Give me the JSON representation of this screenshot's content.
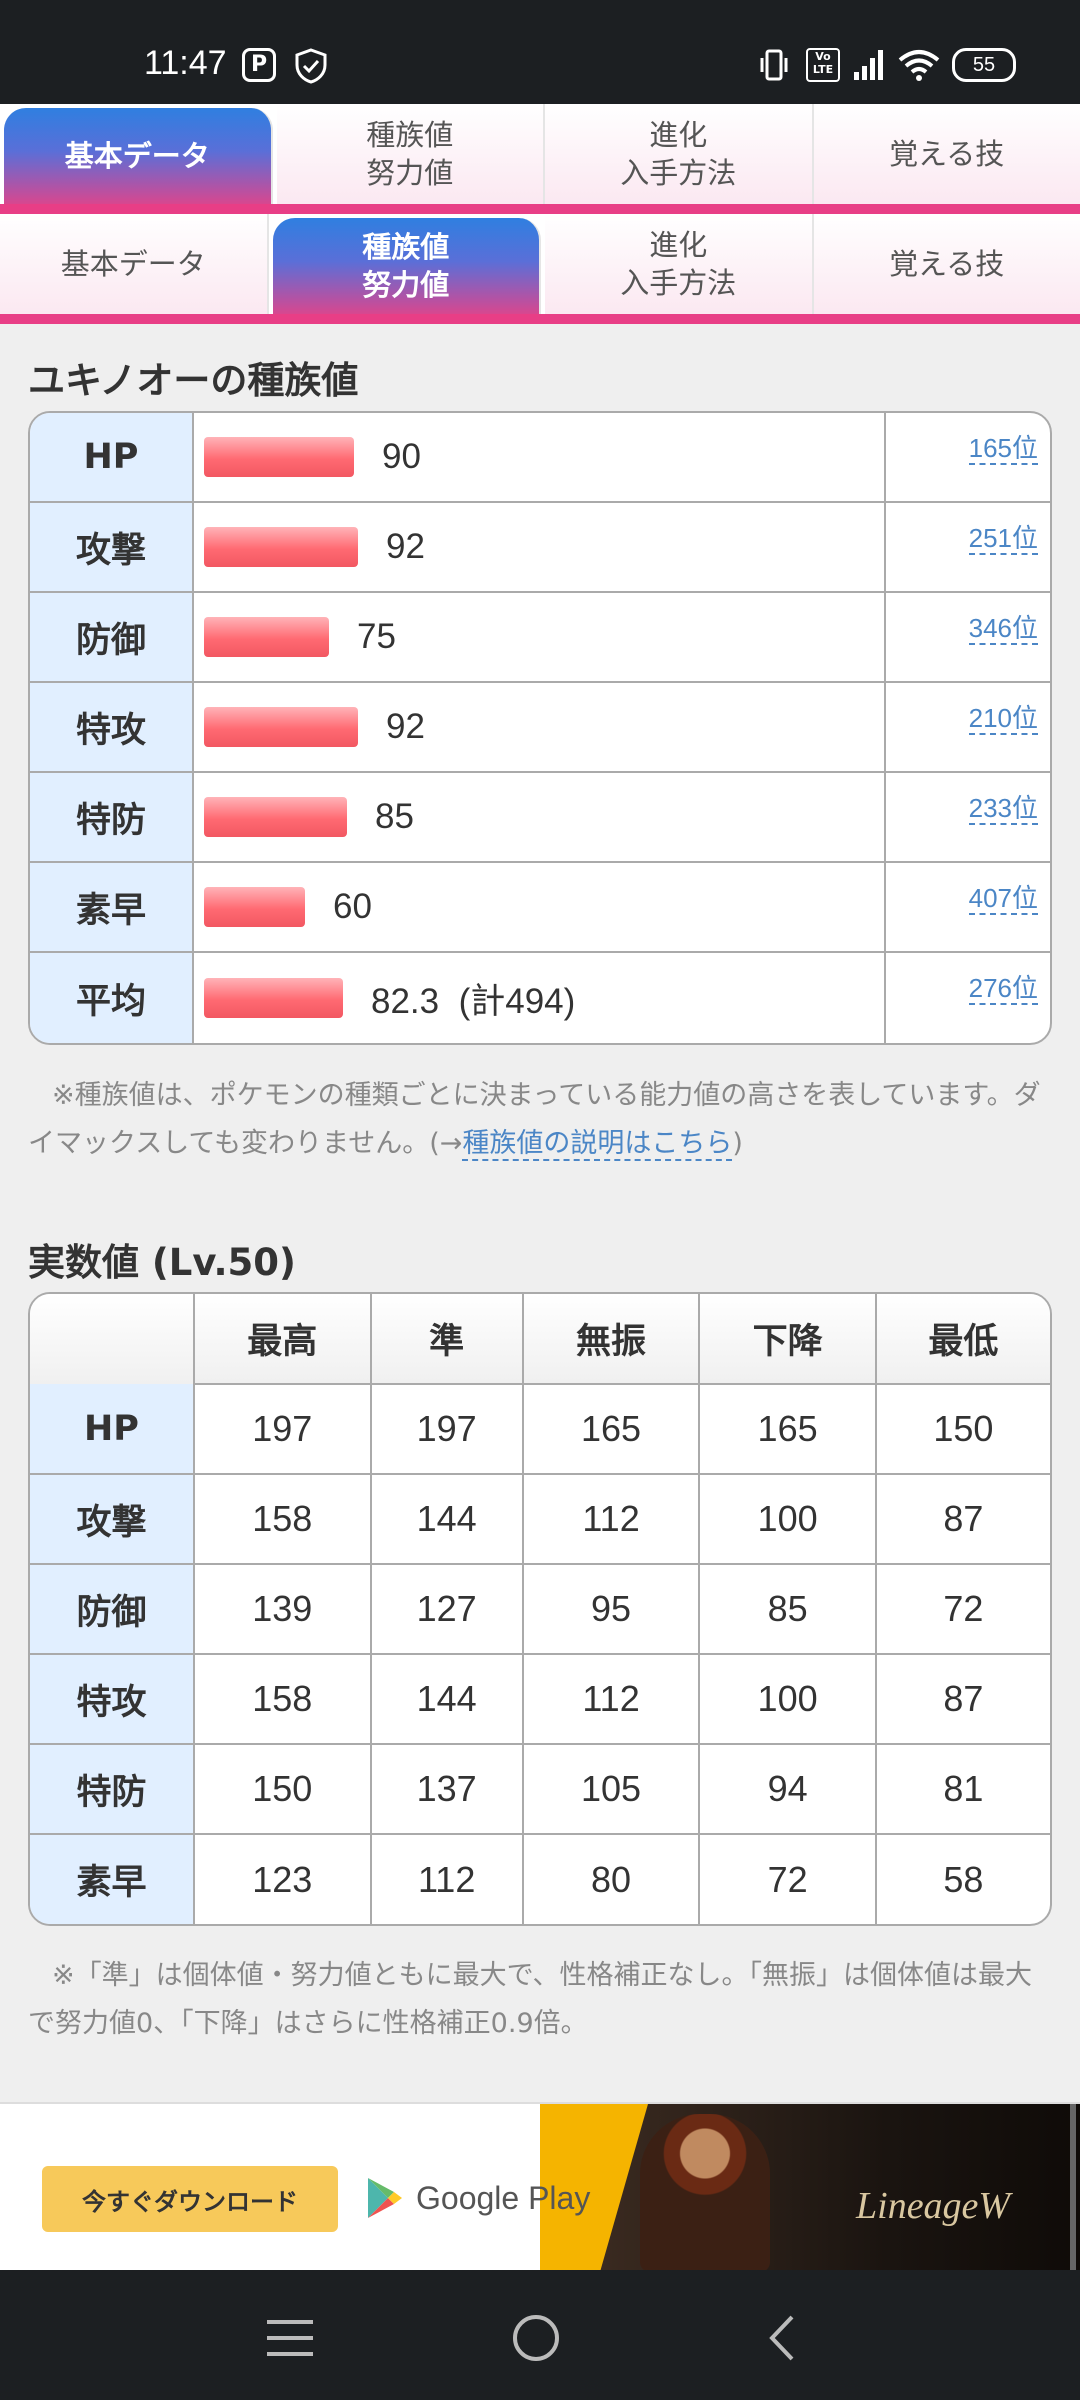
{
  "status_bar": {
    "time": "11:47",
    "app_icon_letter": "P",
    "battery": "55",
    "volte": "Vo LTE"
  },
  "tabs_top": [
    {
      "label": "基本データ",
      "active": true
    },
    {
      "label": "種族値\n努力値",
      "active": false
    },
    {
      "label": "進化\n入手方法",
      "active": false
    },
    {
      "label": "覚える技",
      "active": false
    }
  ],
  "tabs_second": [
    {
      "label": "基本データ",
      "active": false
    },
    {
      "label": "種族値\n努力値",
      "active": true
    },
    {
      "label": "進化\n入手方法",
      "active": false
    },
    {
      "label": "覚える技",
      "active": false
    }
  ],
  "base_stats": {
    "title": "ユキノオーの種族値",
    "rows": [
      {
        "label": "HP",
        "value": "90",
        "bar_ratio": 0.34,
        "rank": "165位"
      },
      {
        "label": "攻撃",
        "value": "92",
        "bar_ratio": 0.35,
        "rank": "251位"
      },
      {
        "label": "防御",
        "value": "75",
        "bar_ratio": 0.285,
        "rank": "346位"
      },
      {
        "label": "特攻",
        "value": "92",
        "bar_ratio": 0.35,
        "rank": "210位"
      },
      {
        "label": "特防",
        "value": "85",
        "bar_ratio": 0.325,
        "rank": "233位"
      },
      {
        "label": "素早",
        "value": "60",
        "bar_ratio": 0.23,
        "rank": "407位"
      },
      {
        "label": "平均",
        "value": "82.3  (計494)",
        "bar_ratio": 0.315,
        "rank": "276位"
      }
    ],
    "note_text": "※種族値は、ポケモンの種類ごとに決まっている能力値の高さを表しています。ダイマックスしても変わりません。(→",
    "note_link": "種族値の説明はこちら",
    "note_end": ")"
  },
  "real_stats": {
    "title": "実数値 (Lv.50)",
    "columns": [
      "",
      "最高",
      "準",
      "無振",
      "下降",
      "最低"
    ],
    "rows": [
      {
        "label": "HP",
        "values": [
          "197",
          "197",
          "165",
          "165",
          "150"
        ]
      },
      {
        "label": "攻撃",
        "values": [
          "158",
          "144",
          "112",
          "100",
          "87"
        ]
      },
      {
        "label": "防御",
        "values": [
          "139",
          "127",
          "95",
          "85",
          "72"
        ]
      },
      {
        "label": "特攻",
        "values": [
          "158",
          "144",
          "112",
          "100",
          "87"
        ]
      },
      {
        "label": "特防",
        "values": [
          "150",
          "137",
          "105",
          "94",
          "81"
        ]
      },
      {
        "label": "素早",
        "values": [
          "123",
          "112",
          "80",
          "72",
          "58"
        ]
      }
    ],
    "note": "※「準」は個体値・努力値ともに最大で、性格補正なし。「無振」は個体値は最大で努力値0、「下降」はさらに性格補正0.9倍。"
  },
  "ad": {
    "button_label": "今すぐダウンロード",
    "store_label": "Google Play",
    "brand": "LineageW"
  },
  "colors": {
    "accent_pink": "#e83e86",
    "tab_blue": "#2f7fe0",
    "bar_red": "#ff6a72",
    "label_bg": "#e1efff",
    "link_blue": "#4b86c6"
  }
}
